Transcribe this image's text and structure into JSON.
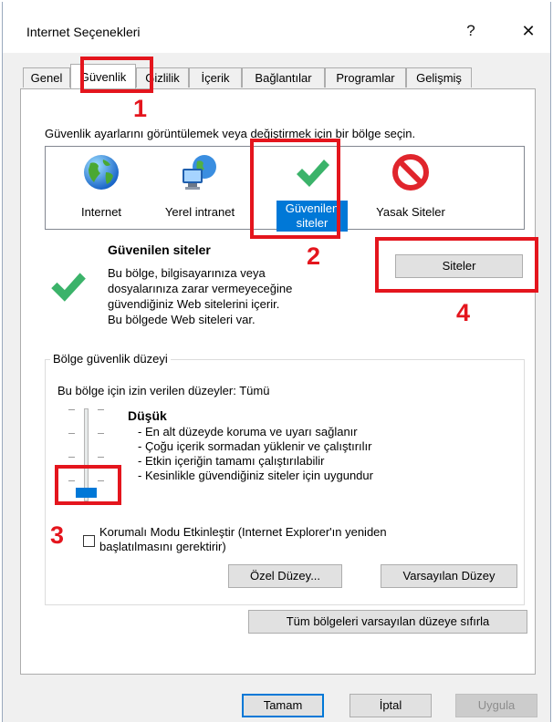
{
  "window": {
    "title": "Internet Seçenekleri",
    "help": "?",
    "close": "✕"
  },
  "tabs": [
    {
      "label": "Genel"
    },
    {
      "label": "Güvenlik",
      "active": true
    },
    {
      "label": "Gizlilik"
    },
    {
      "label": "İçerik"
    },
    {
      "label": "Bağlantılar"
    },
    {
      "label": "Programlar"
    },
    {
      "label": "Gelişmiş"
    }
  ],
  "security": {
    "intro": "Güvenlik ayarlarını görüntülemek veya değiştirmek için bir bölge seçin.",
    "zones": [
      {
        "label": "Internet",
        "icon": "globe-icon"
      },
      {
        "label": "Yerel intranet",
        "icon": "intranet-icon"
      },
      {
        "label_line1": "Güvenilen",
        "label_line2": "siteler",
        "icon": "checkmark-icon",
        "selected": true
      },
      {
        "label": "Yasak Siteler",
        "icon": "blocked-icon"
      }
    ],
    "selected_zone": {
      "title": "Güvenilen siteler",
      "description": [
        "Bu bölge, bilgisayarınıza veya",
        "dosyalarınıza zarar vermeyeceğine",
        "güvendiğiniz Web sitelerini içerir.",
        "Bu bölgede Web siteleri var."
      ]
    },
    "sites_button": "Siteler",
    "level_group": {
      "legend": "Bölge güvenlik düzeyi",
      "allowed_levels": "Bu bölge için izin verilen düzeyler: Tümü",
      "level_name": "Düşük",
      "level_bullets": [
        "- En alt düzeyde koruma ve uyarı sağlanır",
        "- Çoğu içerik sormadan yüklenir ve çalıştırılır",
        "- Etkin içeriğin tamamı çalıştırılabilir",
        "- Kesinlikle güvendiğiniz siteler için uygundur"
      ],
      "slider_level": 0,
      "protected_mode_line1": "Korumalı Modu Etkinleştir (Internet Explorer'ın yeniden",
      "protected_mode_line2": "başlatılmasını gerektirir)",
      "protected_mode_checked": false,
      "custom_level_button": "Özel Düzey...",
      "default_level_button": "Varsayılan Düzey"
    },
    "reset_all_button": "Tüm bölgeleri varsayılan düzeye sıfırla"
  },
  "footer": {
    "ok": "Tamam",
    "cancel": "İptal",
    "apply": "Uygula"
  },
  "annotations": [
    "1",
    "2",
    "3",
    "4"
  ],
  "colors": {
    "highlight": "#e4151d",
    "accent": "#0078d7"
  }
}
